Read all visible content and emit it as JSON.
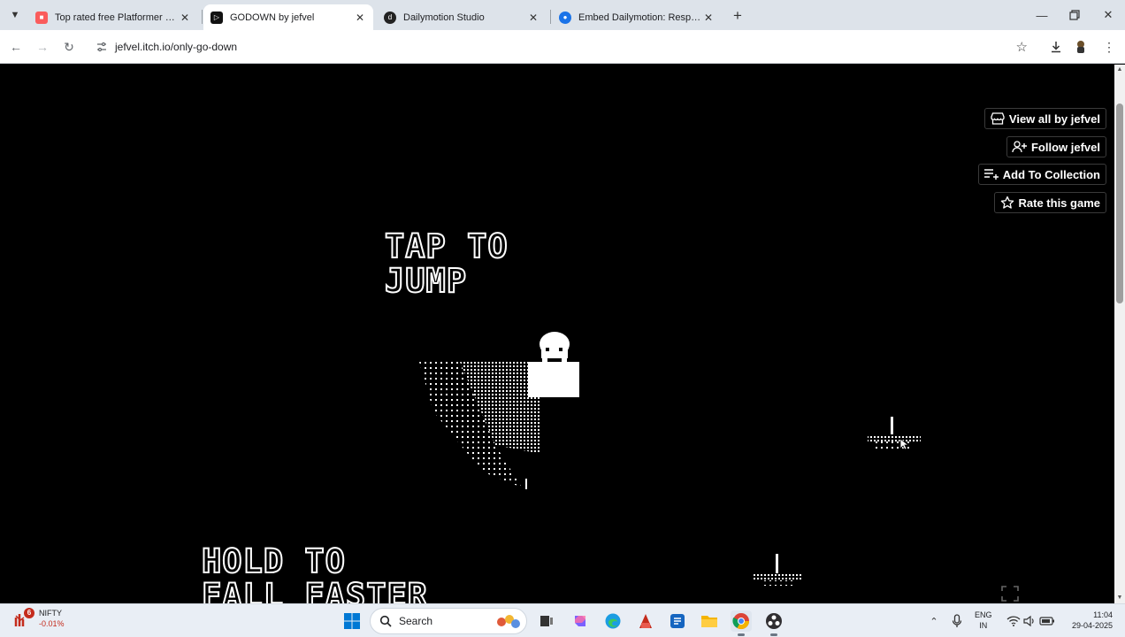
{
  "browser": {
    "tabs": [
      {
        "title": "Top rated free Platformer games",
        "favicon": "itch-io-icon",
        "active": false
      },
      {
        "title": "GODOWN by jefvel",
        "favicon": "game-icon",
        "active": true
      },
      {
        "title": "Dailymotion Studio",
        "favicon": "dailymotion-icon",
        "active": false
      },
      {
        "title": "Embed Dailymotion: Responsive",
        "favicon": "chrome-page-icon",
        "active": false
      }
    ],
    "url": "jefvel.itch.io/only-go-down"
  },
  "itch_buttons": {
    "view_all": "View all by jefvel",
    "follow": "Follow jefvel",
    "add_collection": "Add To Collection",
    "rate": "Rate this game"
  },
  "game": {
    "instruction_1_line1": "TAP TO",
    "instruction_1_line2": "JUMP",
    "instruction_2_line1": "HOLD TO",
    "instruction_2_line2": "FALL FASTER"
  },
  "taskbar": {
    "nifty_label": "NIFTY",
    "nifty_change": "-0.01%",
    "nifty_badge": "6",
    "search_placeholder": "Search",
    "lang_line1": "ENG",
    "lang_line2": "IN",
    "time": "11:04",
    "date": "29-04-2025"
  },
  "colors": {
    "page_bg": "#000000",
    "accent_blue": "#1a73e8",
    "nifty_red": "#c42b1c"
  }
}
